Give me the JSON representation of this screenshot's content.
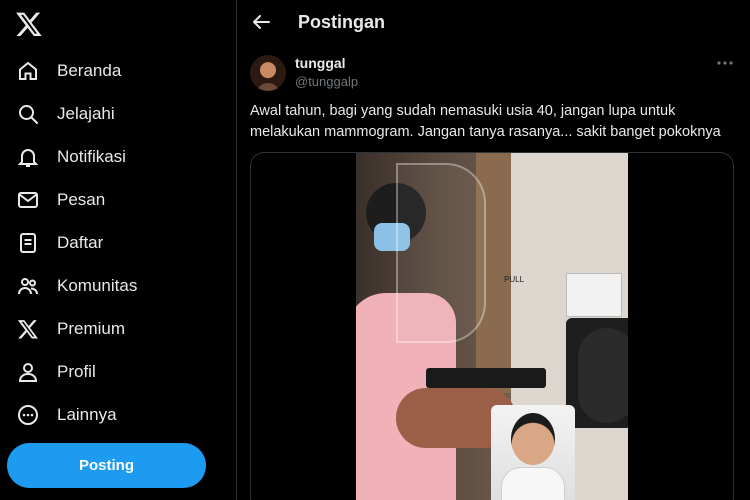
{
  "sidebar": {
    "logo_icon": "x-logo-icon",
    "items": [
      {
        "label": "Beranda",
        "icon": "home-icon"
      },
      {
        "label": "Jelajahi",
        "icon": "search-icon"
      },
      {
        "label": "Notifikasi",
        "icon": "bell-icon"
      },
      {
        "label": "Pesan",
        "icon": "mail-icon"
      },
      {
        "label": "Daftar",
        "icon": "list-icon"
      },
      {
        "label": "Komunitas",
        "icon": "people-icon"
      },
      {
        "label": "Premium",
        "icon": "x-logo-icon"
      },
      {
        "label": "Profil",
        "icon": "person-icon"
      },
      {
        "label": "Lainnya",
        "icon": "more-circle-icon"
      }
    ],
    "post_button": "Posting"
  },
  "header": {
    "title": "Postingan"
  },
  "tweet": {
    "display_name": "tunggal",
    "handle": "@tunggalp",
    "text": "Awal tahun, bagi yang sudah nemasuki usia 40, jangan lupa untuk melakukan mammogram. Jangan tanya rasanya... sakit banget pokoknya",
    "video_sign": "PULL"
  },
  "colors": {
    "background": "#000000",
    "text": "#e7e9ea",
    "muted": "#71767b",
    "accent": "#1d9bf0",
    "border": "#2f3336"
  }
}
